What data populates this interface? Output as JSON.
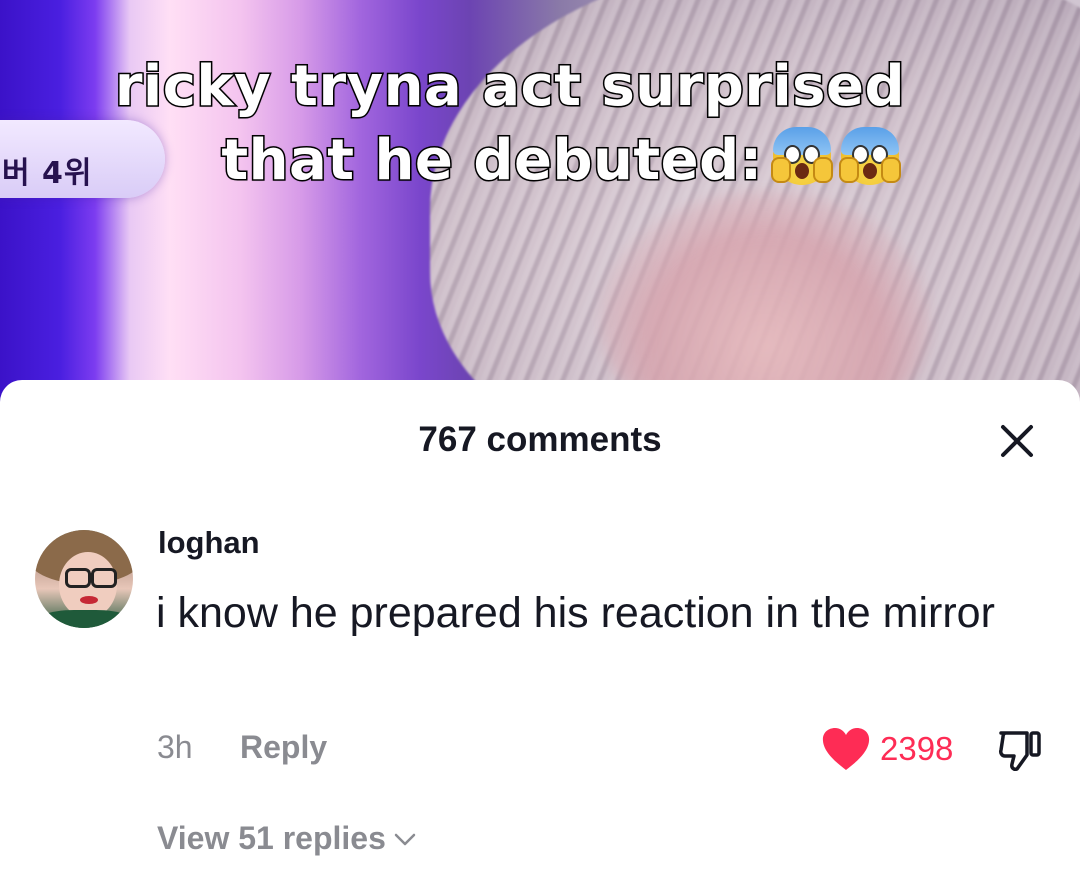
{
  "video": {
    "overlay_text": "버 4위",
    "caption_line1": "ricky tryna act surprised",
    "caption_line2": "that he debuted:",
    "caption_emojis": [
      "face-screaming-in-fear",
      "face-screaming-in-fear"
    ]
  },
  "comments_sheet": {
    "title": "767 comments",
    "close_icon": "close-x-icon",
    "comment": {
      "username": "loghan",
      "avatar": "user-avatar",
      "text": "i know he prepared his reaction in the mirror",
      "timestamp": "3h",
      "reply_label": "Reply",
      "like_icon": "heart-filled-icon",
      "like_count": "2398",
      "dislike_icon": "thumbs-down-icon",
      "view_replies_label": "View 51 replies",
      "view_replies_icon": "chevron-down-icon"
    }
  },
  "colors": {
    "text_primary": "#161823",
    "text_secondary": "#8a8b91",
    "like_red": "#fe2c55"
  }
}
